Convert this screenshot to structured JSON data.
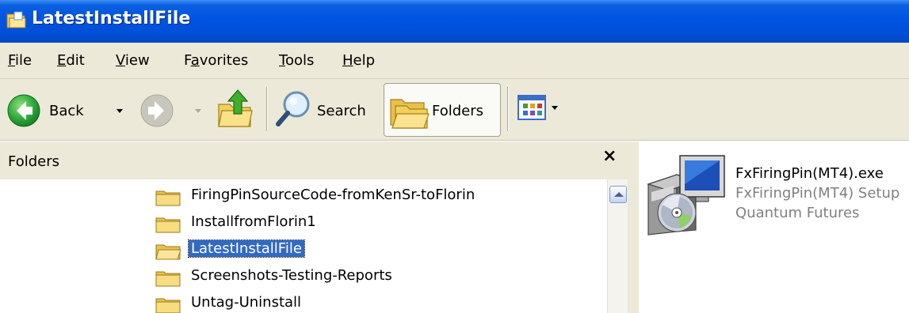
{
  "window": {
    "title": "LatestInstallFile"
  },
  "menu": [
    {
      "label": "File",
      "accel": "F",
      "rest": "ile"
    },
    {
      "label": "Edit",
      "accel": "E",
      "rest": "dit"
    },
    {
      "label": "View",
      "accel": "V",
      "rest": "iew"
    },
    {
      "label": "Favorites",
      "pre": "F",
      "accel": "a",
      "rest": "vorites"
    },
    {
      "label": "Tools",
      "accel": "T",
      "rest": "ools"
    },
    {
      "label": "Help",
      "accel": "H",
      "rest": "elp"
    }
  ],
  "toolbar": {
    "back_label": "Back",
    "search_label": "Search",
    "folders_label": "Folders",
    "back_icon": "back-arrow-icon",
    "forward_icon": "forward-arrow-icon",
    "up_icon": "folder-up-icon",
    "search_icon": "magnifier-icon",
    "folders_icon": "folders-icon",
    "views_icon": "views-icon"
  },
  "folders_pane": {
    "header": "Folders",
    "close_glyph": "×",
    "items": [
      {
        "label": "FiringPinSourceCode-fromKenSr-toFlorin",
        "selected": false
      },
      {
        "label": "InstallfromFlorin1",
        "selected": false
      },
      {
        "label": "LatestInstallFile",
        "selected": true
      },
      {
        "label": "Screenshots-Testing-Reports",
        "selected": false
      },
      {
        "label": "Untag-Uninstall",
        "selected": false
      }
    ]
  },
  "file": {
    "name": "FxFiringPin(MT4).exe",
    "description": "FxFiringPin(MT4) Setup",
    "company": "Quantum Futures",
    "icon": "installer-package-icon"
  },
  "colors": {
    "titlebar": "#0054e3",
    "chrome": "#ece9d8",
    "selection": "#316ac5",
    "folder_yellow": "#f6d36b"
  }
}
